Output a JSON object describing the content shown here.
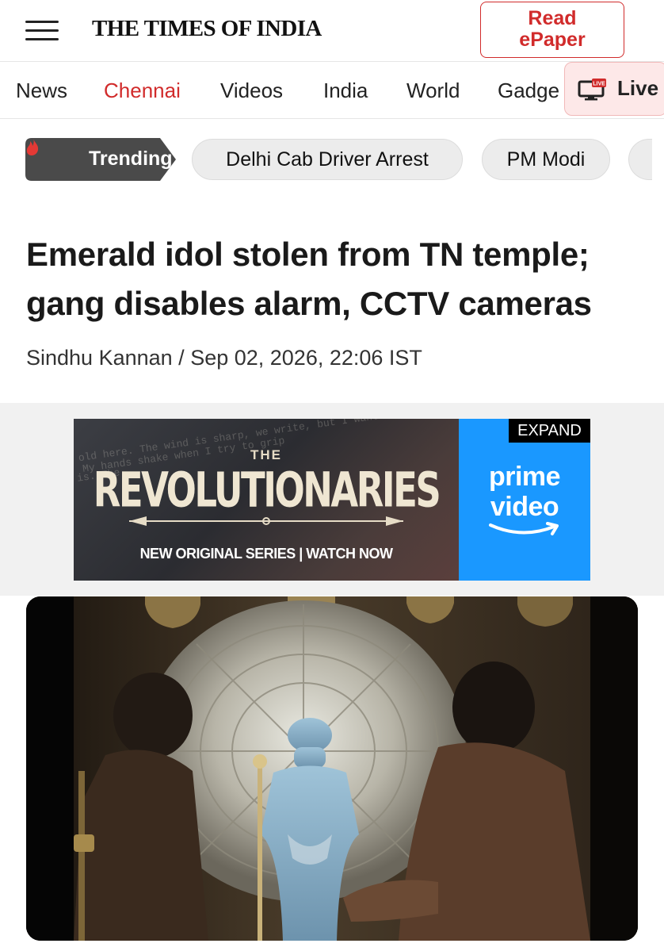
{
  "header": {
    "logo": "THE TIMES OF INDIA",
    "epaper_line1": "Read",
    "epaper_line2": "ePaper"
  },
  "nav": {
    "items": [
      "News",
      "Chennai",
      "Videos",
      "India",
      "World",
      "Gadge"
    ],
    "active": "Chennai",
    "live_badge": "LIVE",
    "live_label": "Live"
  },
  "trending": {
    "label": "Trending",
    "topics": [
      "Delhi Cab Driver Arrest",
      "PM Modi"
    ]
  },
  "article": {
    "headline": "Emerald idol stolen from TN temple; gang disables alarm, CCTV cameras",
    "author": "Sindhu Kannan",
    "separator": " / ",
    "date": "Sep 02, 2026, 22:06 IST"
  },
  "ad": {
    "title_small": "THE",
    "title": "REVOLUTIONARIES",
    "cta": "NEW ORIGINAL SERIES | WATCH NOW",
    "expand": "EXPAND",
    "brand_line1": "prime",
    "brand_line2": "video",
    "background_script": [
      "old here. The wind is sharp, we write, but I want to",
      "My hands shake when I try to grip",
      "is. The"
    ]
  },
  "colors": {
    "accent_red": "#d12b2b",
    "prime_blue": "#1a98ff",
    "trending_bg": "#4a4a4a"
  }
}
